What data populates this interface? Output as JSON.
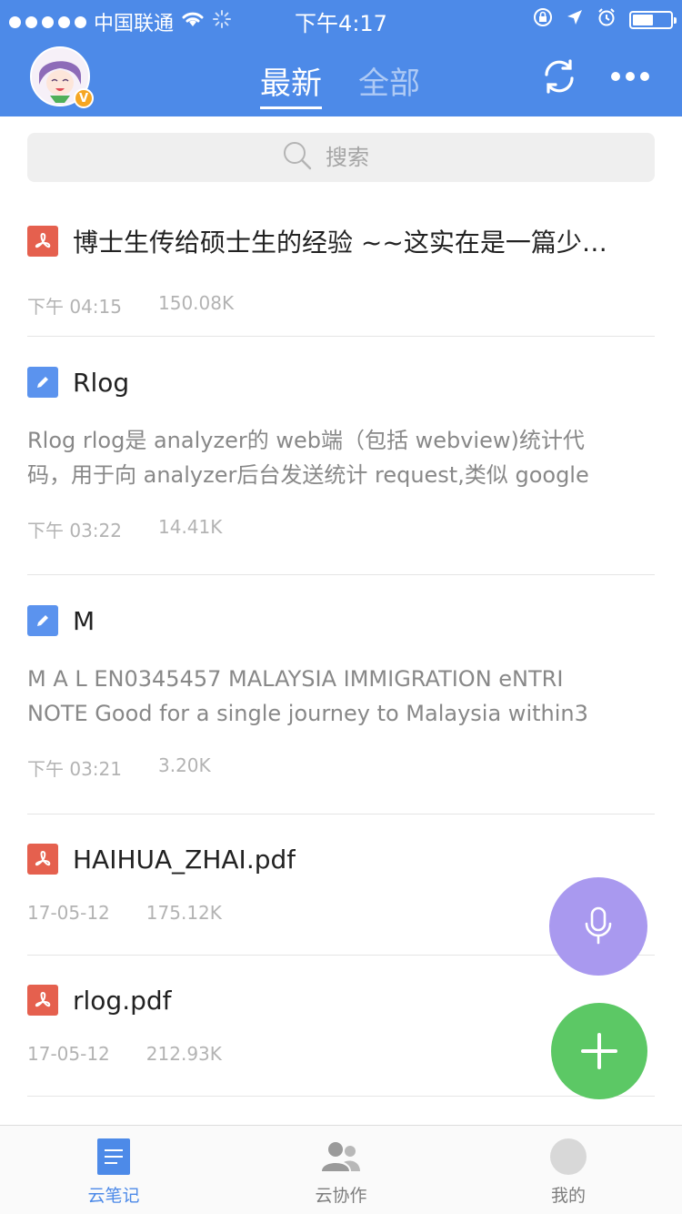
{
  "status_bar": {
    "carrier": "中国联通",
    "time": "下午4:17",
    "battery_level": 0.55
  },
  "header": {
    "tabs": [
      {
        "label": "最新",
        "active": true
      },
      {
        "label": "全部",
        "active": false
      }
    ],
    "avatar_badge": "V",
    "icons": [
      "refresh-icon",
      "more-icon"
    ]
  },
  "search": {
    "placeholder": "搜索"
  },
  "notes": [
    {
      "type": "pdf",
      "title": "博士生传给硕士生的经验 ~~这实在是一篇少…",
      "time": "下午 04:15",
      "size": "150.08K"
    },
    {
      "type": "note",
      "title": "Rlog",
      "snippet_line1": "Rlog  rlog是 analyzer的 web端（包括 webview)统计代",
      "snippet_line2": "码，用于向 analyzer后台发送统计 request,类似 google",
      "time": "下午 03:22",
      "size": "14.41K"
    },
    {
      "type": "note",
      "title": "M",
      "snippet_line1": "M  A  L  EN0345457  MALAYSIA IMMIGRATION eNTRI",
      "snippet_line2": "NOTE Good for a single journey to Malaysia within3",
      "time": "下午 03:21",
      "size": "3.20K"
    },
    {
      "type": "pdf",
      "title": "HAIHUA_ZHAI.pdf",
      "time": "17-05-12",
      "size": "175.12K"
    },
    {
      "type": "pdf",
      "title": "rlog.pdf",
      "time": "17-05-12",
      "size": "212.93K"
    }
  ],
  "tabbar": {
    "items": [
      {
        "label": "云笔记",
        "icon": "notes-icon",
        "active": true
      },
      {
        "label": "云协作",
        "icon": "people-icon",
        "active": false
      },
      {
        "label": "我的",
        "icon": "profile-icon",
        "active": false
      }
    ]
  },
  "colors": {
    "brand_blue": "#4d8ae8",
    "pdf_red": "#e5604e",
    "note_blue": "#5b93ee",
    "mic_purple": "#a999ef",
    "add_green": "#5cc865"
  }
}
